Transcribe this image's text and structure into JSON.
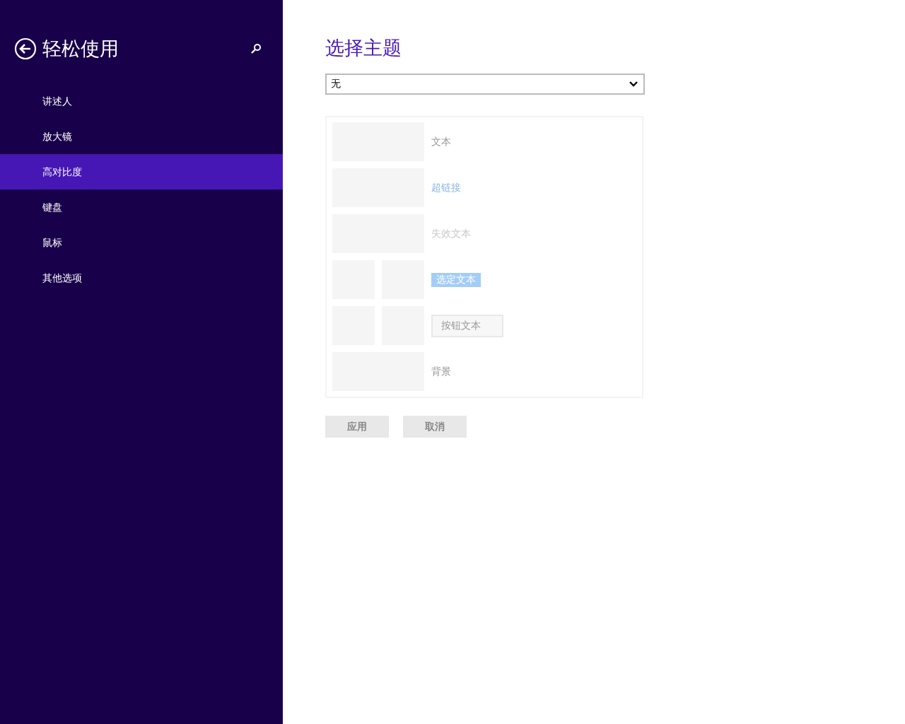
{
  "sidebar": {
    "title": "轻松使用",
    "items": [
      {
        "label": "讲述人",
        "selected": false
      },
      {
        "label": "放大镜",
        "selected": false
      },
      {
        "label": "高对比度",
        "selected": true
      },
      {
        "label": "键盘",
        "selected": false
      },
      {
        "label": "鼠标",
        "selected": false
      },
      {
        "label": "其他选项",
        "selected": false
      }
    ]
  },
  "content": {
    "heading": "选择主题",
    "theme_select": {
      "value": "无"
    },
    "preview": [
      {
        "kind": "text",
        "label": "文本"
      },
      {
        "kind": "link",
        "label": "超链接"
      },
      {
        "kind": "disabled",
        "label": "失效文本"
      },
      {
        "kind": "selected",
        "label": "选定文本"
      },
      {
        "kind": "button",
        "label": "按钮文本"
      },
      {
        "kind": "background",
        "label": "背景"
      }
    ],
    "buttons": [
      {
        "label": "应用",
        "disabled": true
      },
      {
        "label": "取消",
        "disabled": true
      }
    ]
  }
}
